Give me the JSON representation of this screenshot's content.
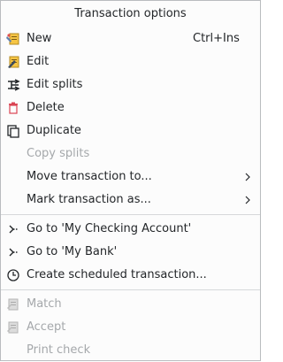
{
  "menu": {
    "title": "Transaction options",
    "items": {
      "new": {
        "label": "New",
        "shortcut": "Ctrl+Ins",
        "icon": "new-transaction-icon"
      },
      "edit": {
        "label": "Edit",
        "icon": "edit-transaction-icon"
      },
      "edit_splits": {
        "label": "Edit splits",
        "icon": "split-icon"
      },
      "delete": {
        "label": "Delete",
        "icon": "trash-icon"
      },
      "duplicate": {
        "label": "Duplicate",
        "icon": "duplicate-icon"
      },
      "copy_splits": {
        "label": "Copy splits",
        "disabled": true
      },
      "move_to": {
        "label": "Move transaction to...",
        "submenu": true
      },
      "mark_as": {
        "label": "Mark transaction as...",
        "submenu": true
      },
      "goto_account": {
        "label": "Go to 'My Checking Account'",
        "icon": "goto-arrow-icon"
      },
      "goto_payee": {
        "label": "Go to 'My Bank'",
        "icon": "goto-arrow-icon"
      },
      "create_scheduled": {
        "label": "Create scheduled transaction...",
        "icon": "clock-icon"
      },
      "match": {
        "label": "Match",
        "icon": "match-transaction-icon",
        "disabled": true
      },
      "accept": {
        "label": "Accept",
        "icon": "accept-transaction-icon",
        "disabled": true
      },
      "print_check": {
        "label": "Print check",
        "disabled": true
      }
    }
  }
}
